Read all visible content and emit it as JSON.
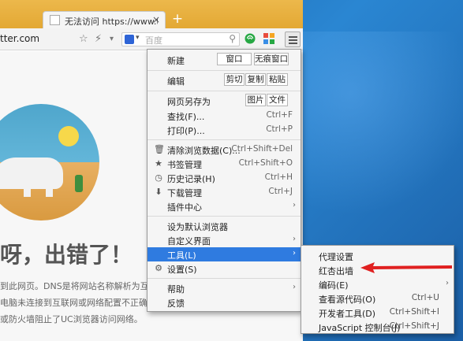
{
  "colors": {
    "tabbar": "#e8b03d",
    "menu_highlight": "#2f7be0",
    "annotation_arrow": "#e02020",
    "desktop": "#2477c4"
  },
  "browser": {
    "tab_title": "无法访问 https://www.tw",
    "tab_close": "×",
    "new_tab": "+",
    "url": "tter.com",
    "search_placeholder": "百度",
    "search_caret": "▾",
    "icons": {
      "star": "☆",
      "bolt": "⚡",
      "dropdown": "▾",
      "search": "⚲"
    }
  },
  "page": {
    "headline": "呀，出错了！",
    "lines": [
      "到此网页。DNS是将网站名称解析为互联网",
      "电脑未连接到互联网或网络配置不正确，",
      "或防火墙阻止了UC浏览器访问网络。"
    ]
  },
  "menu": {
    "new_label": "新建",
    "new_window": "窗口",
    "new_incognito": "无痕窗口",
    "edit_label": "编辑",
    "cut": "剪切",
    "copy": "复制",
    "paste": "粘贴",
    "save_as_label": "网页另存为",
    "save_image": "图片",
    "save_file": "文件",
    "find_label": "查找(F)...",
    "find_short": "Ctrl+F",
    "print_label": "打印(P)...",
    "print_short": "Ctrl+P",
    "clear_label": "清除浏览数据(C)...",
    "clear_short": "Ctrl+Shift+Del",
    "bookmarks_label": "书签管理",
    "bookmarks_short": "Ctrl+Shift+O",
    "history_label": "历史记录(H)",
    "history_short": "Ctrl+H",
    "downloads_label": "下载管理",
    "downloads_short": "Ctrl+J",
    "plugins_label": "插件中心",
    "default_label": "设为默认浏览器",
    "customize_label": "自定义界面",
    "tools_label": "工具(L)",
    "settings_label": "设置(S)",
    "help_label": "帮助",
    "feedback_label": "反馈",
    "arrow": "›"
  },
  "submenu": {
    "proxy": "代理设置",
    "vpn": "红杏出墙",
    "encoding": "编码(E)",
    "source": "查看源代码(O)",
    "source_short": "Ctrl+U",
    "devtools": "开发者工具(D)",
    "devtools_short": "Ctrl+Shift+I",
    "console": "JavaScript 控制台(J)",
    "console_short": "Ctrl+Shift+J"
  }
}
